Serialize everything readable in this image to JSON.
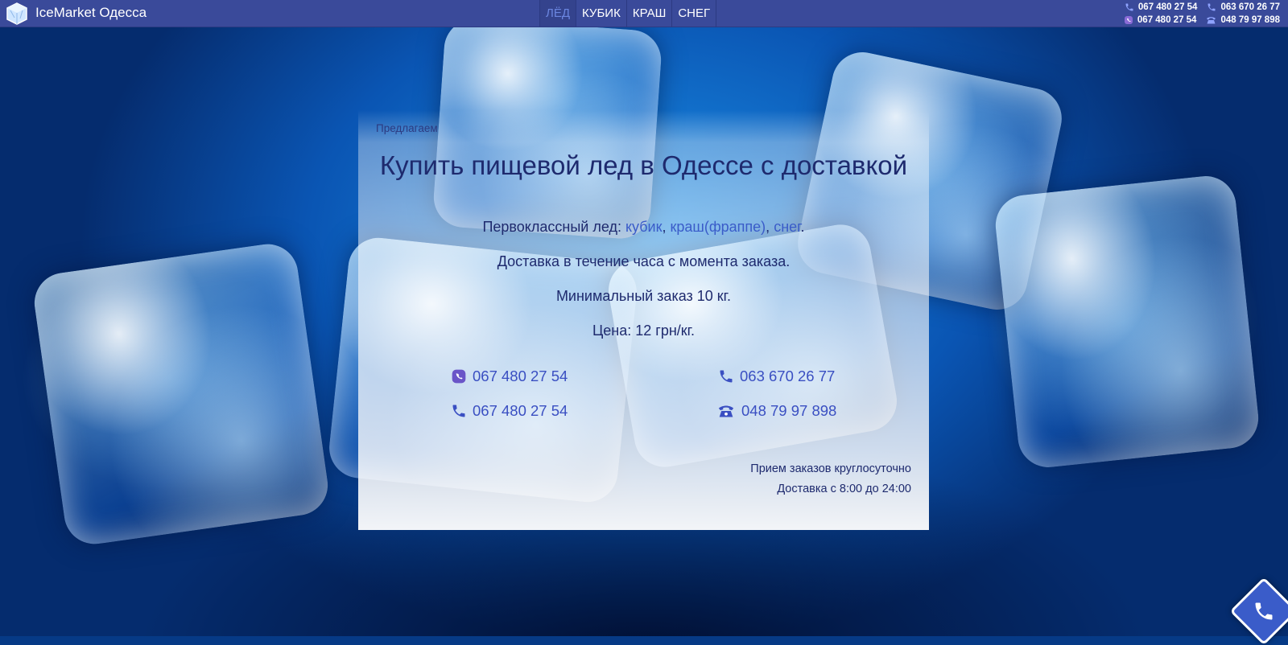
{
  "header": {
    "brand": "IceMarket Одесса",
    "logo_icon": "ice-cube-logo",
    "nav": [
      {
        "label": "ЛЁД",
        "active": true
      },
      {
        "label": "КУБИК",
        "active": false
      },
      {
        "label": "КРАШ",
        "active": false
      },
      {
        "label": "СНЕГ",
        "active": false
      }
    ],
    "phones": [
      {
        "number": "067 480 27 54",
        "icon": "phone-icon"
      },
      {
        "number": "063 670 26 77",
        "icon": "phone-icon"
      },
      {
        "number": "067 480 27 54",
        "icon": "viber-icon"
      },
      {
        "number": "048 79 97 898",
        "icon": "landline-phone-icon"
      }
    ]
  },
  "main": {
    "pre": "Предлагаем",
    "title": "Купить пищевой лед в Одессе с доставкой",
    "offer_prefix": "Первоклассный лед: ",
    "offer_links": [
      "кубик",
      "краш(фраппе)",
      "снег"
    ],
    "offer_sep1": ", ",
    "offer_sep2": ", ",
    "offer_end": ".",
    "delivery": "Доставка в течение часа с момента заказа.",
    "min_order": "Минимальный заказ 10 кг.",
    "price": "Цена: 12 грн/кг.",
    "phones": [
      {
        "number": "067 480 27 54",
        "icon": "viber-icon"
      },
      {
        "number": "063 670 26 77",
        "icon": "phone-icon"
      },
      {
        "number": "067 480 27 54",
        "icon": "phone-icon"
      },
      {
        "number": "048 79 97 898",
        "icon": "landline-phone-icon"
      }
    ],
    "hours_orders": "Прием заказов круглосуточно",
    "hours_delivery": "Доставка с 8:00 до 24:00"
  },
  "colors": {
    "topbar": "#3a4a9a",
    "accent": "#3a5cc9",
    "text_dark": "#1e2a6e"
  }
}
